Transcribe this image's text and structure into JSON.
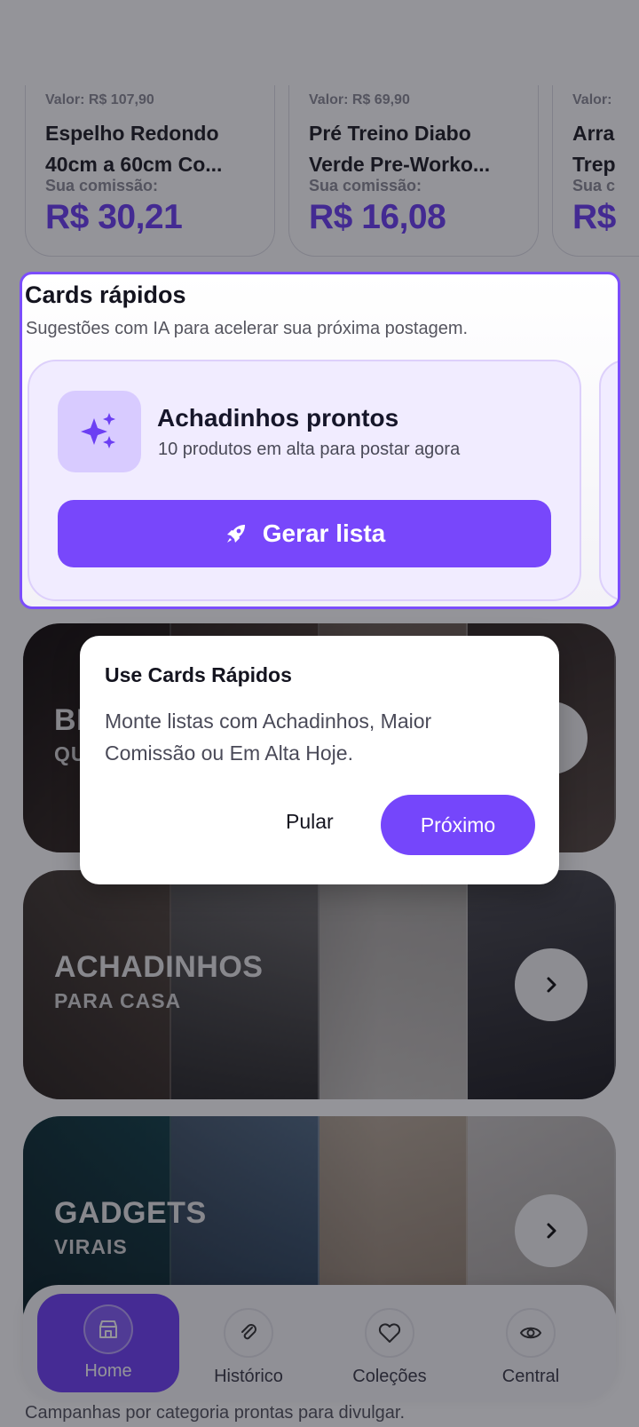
{
  "products": [
    {
      "price": "Valor: R$ 107,90",
      "name_line1": "Espelho Redondo",
      "name_line2": "40cm a 60cm Co...",
      "commission_label": "Sua comissão:",
      "commission": "R$ 30,21"
    },
    {
      "price": "Valor: R$ 69,90",
      "name_line1": "Pré Treino Diabo",
      "name_line2": "Verde Pre-Worko...",
      "commission_label": "Sua comissão:",
      "commission": "R$ 16,08"
    },
    {
      "price": "Valor:",
      "name_line1": "Arra",
      "name_line2": "Trep",
      "commission_label": "Sua c",
      "commission": "R$"
    }
  ],
  "quick_cards": {
    "title": "Cards rápidos",
    "subtitle": "Sugestões com IA para acelerar sua próxima postagem.",
    "card": {
      "icon": "sparkles-icon",
      "title": "Achadinhos prontos",
      "description": "10 produtos em alta para postar agora",
      "button_icon": "rocket-icon",
      "button_label": "Gerar lista"
    }
  },
  "banners": [
    {
      "title": "BI",
      "subtitle": "QU",
      "colors": [
        "#3a2a22",
        "#6b5448",
        "#8a7466",
        "#5a4a40"
      ]
    },
    {
      "title": "ACHADINHOS",
      "subtitle": "PARA CASA",
      "colors": [
        "#6e5c4c",
        "#5e5e5e",
        "#b8b4ae",
        "#3a3a3e"
      ]
    },
    {
      "title": "GADGETS",
      "subtitle": "VIRAIS",
      "colors": [
        "#1e5a66",
        "#4e6e8e",
        "#c4b4a0",
        "#d8d2cc"
      ]
    }
  ],
  "dialog": {
    "title": "Use Cards Rápidos",
    "message": "Monte listas com Achadinhos, Maior Comissão ou Em Alta Hoje.",
    "skip_label": "Pular",
    "next_label": "Próximo"
  },
  "footer_text": "Campanhas por categoria prontas para divulgar.",
  "nav": [
    {
      "label": "Home",
      "icon": "store-icon",
      "active": true
    },
    {
      "label": "Histórico",
      "icon": "paperclip-icon",
      "active": false
    },
    {
      "label": "Coleções",
      "icon": "heart-icon",
      "active": false
    },
    {
      "label": "Central",
      "icon": "eye-icon",
      "active": false
    }
  ],
  "colors": {
    "accent": "#7546fb",
    "overlay": "rgba(18,18,28,0.45)"
  }
}
